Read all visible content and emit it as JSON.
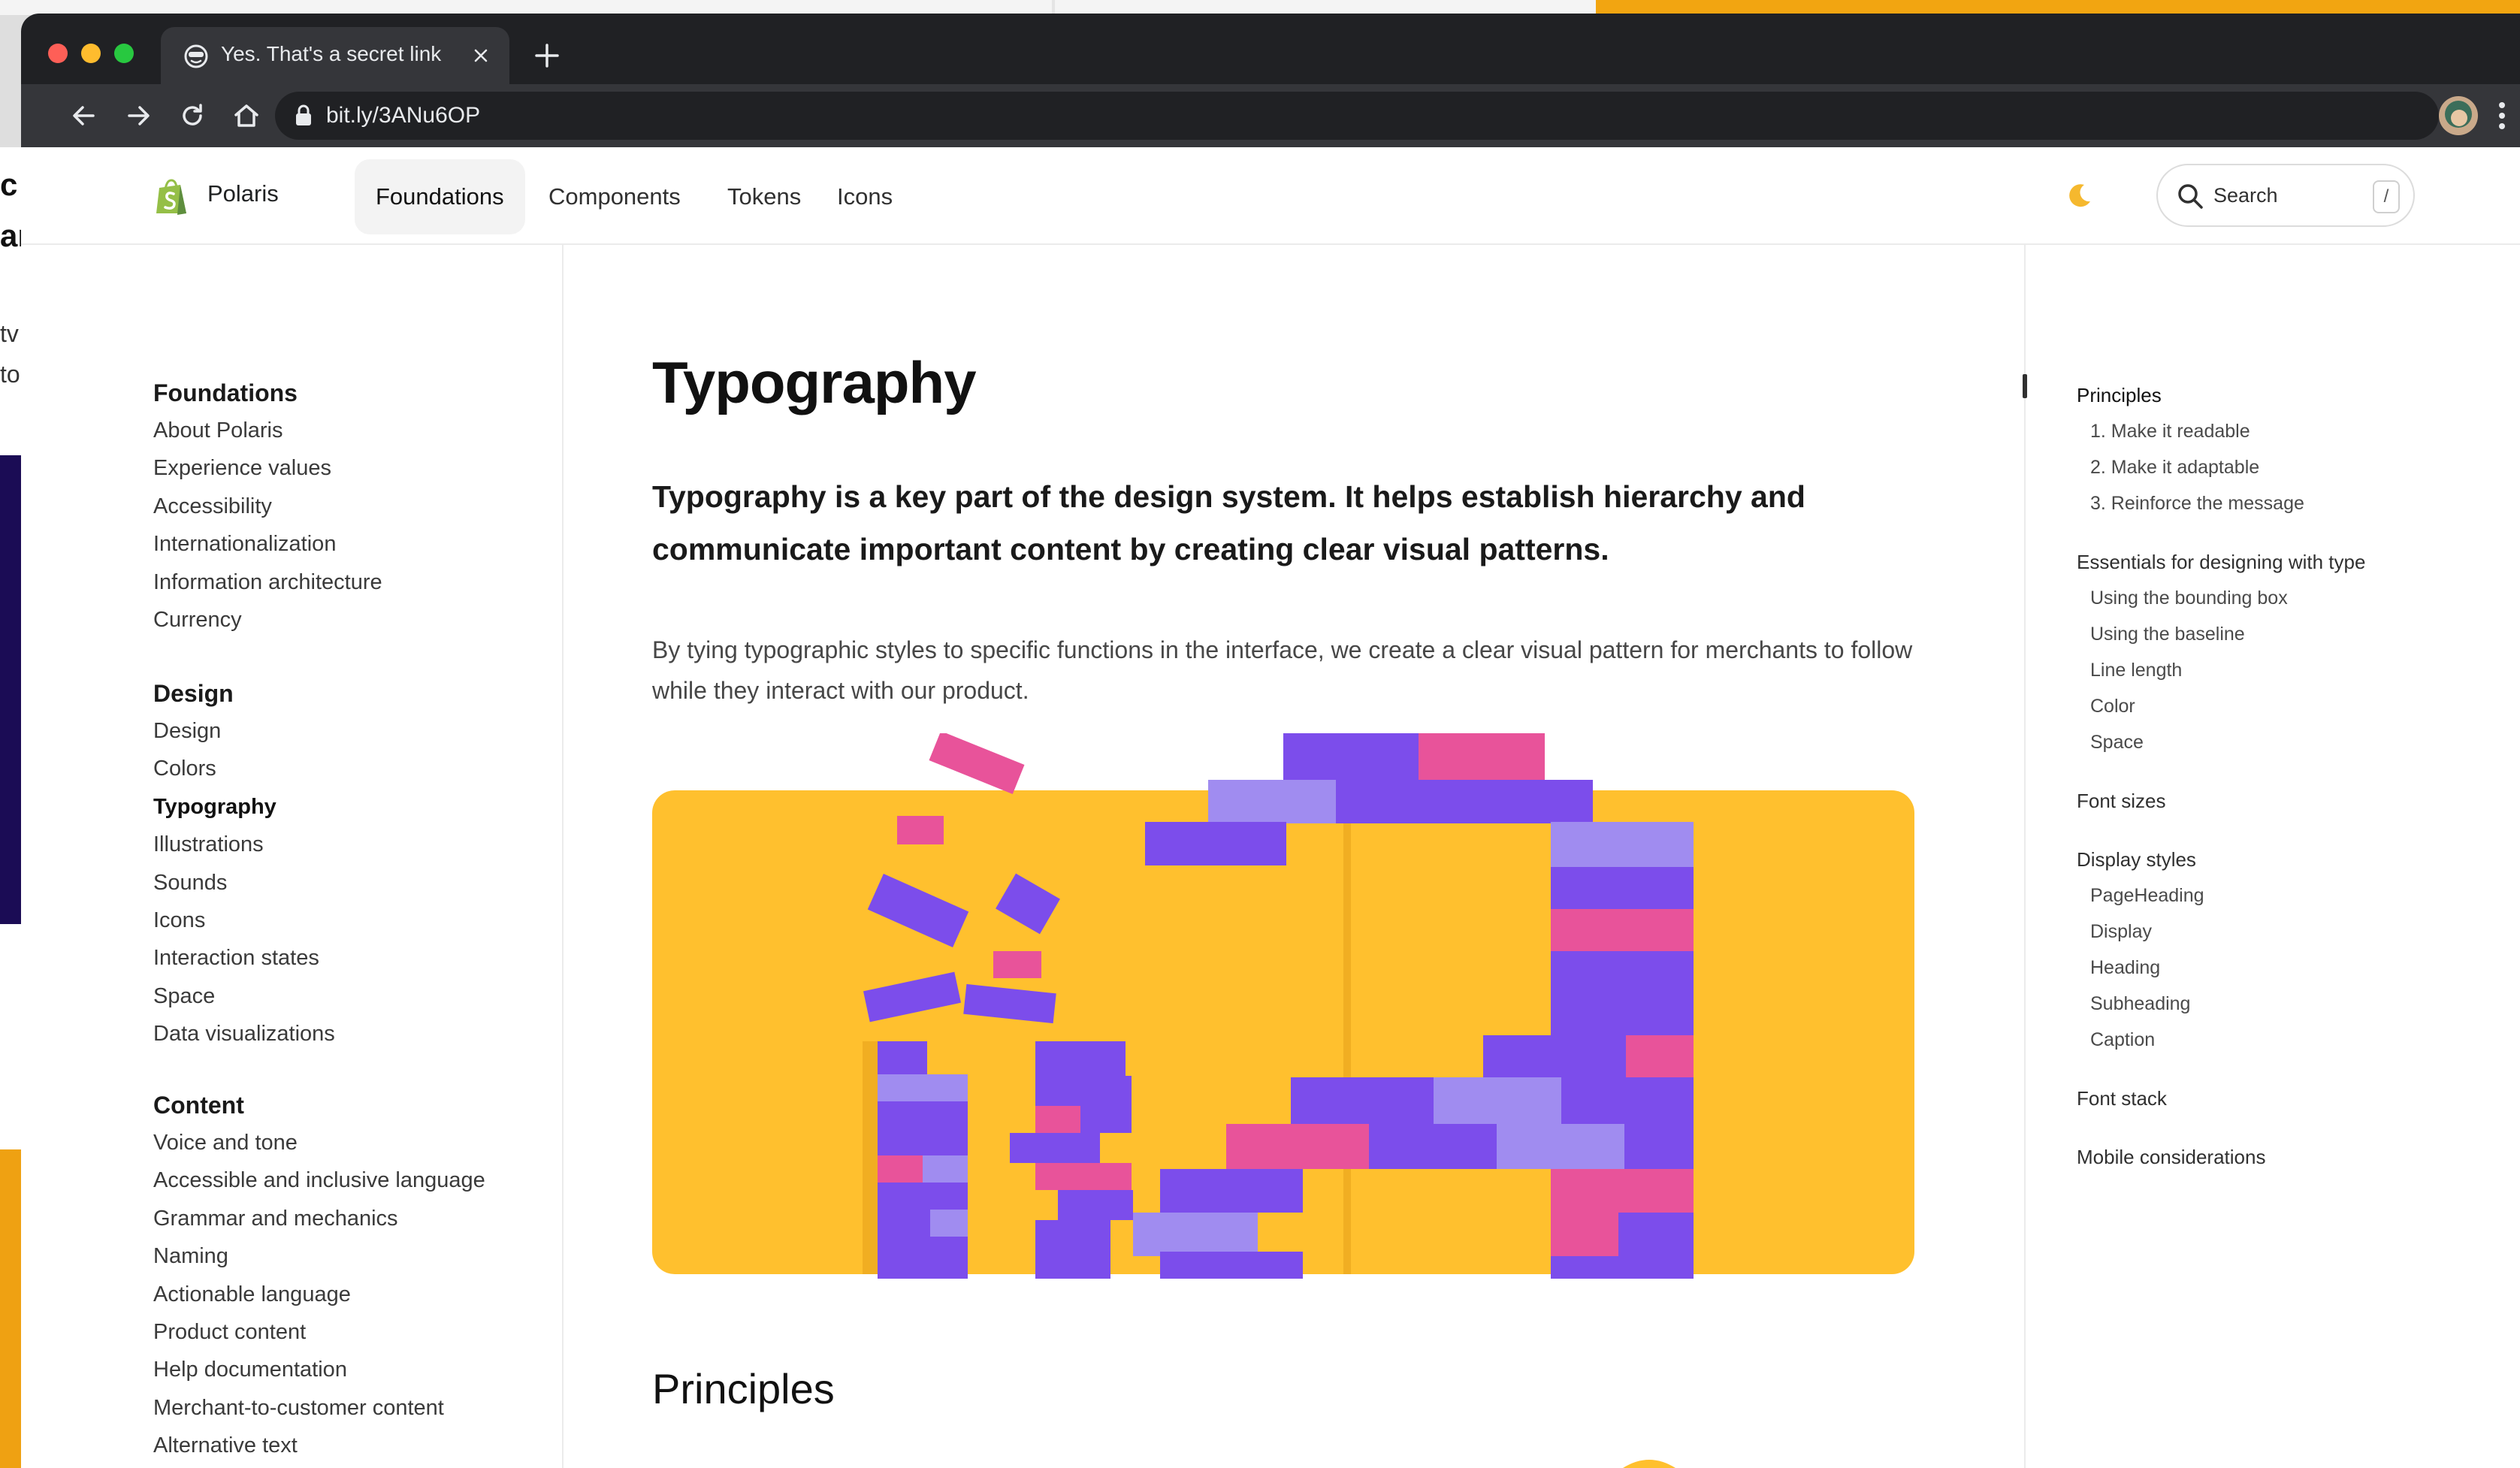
{
  "browser": {
    "tab_title": "Yes. That's a secret link",
    "url": "bit.ly/3ANu6OP"
  },
  "background": {
    "left_letters": [
      "c",
      "ar",
      "tv",
      "to"
    ]
  },
  "site": {
    "brand": "Polaris",
    "nav": [
      "Foundations",
      "Components",
      "Tokens",
      "Icons"
    ],
    "active_nav": "Foundations",
    "search_label": "Search",
    "search_shortcut": "/"
  },
  "sidebar": {
    "groups": [
      {
        "heading": "Foundations",
        "items": [
          "About Polaris",
          "Experience values",
          "Accessibility",
          "Internationalization",
          "Information architecture",
          "Currency"
        ]
      },
      {
        "heading": "Design",
        "items": [
          "Design",
          "Colors",
          "Typography",
          "Illustrations",
          "Sounds",
          "Icons",
          "Interaction states",
          "Space",
          "Data visualizations"
        ]
      },
      {
        "heading": "Content",
        "items": [
          "Voice and tone",
          "Accessible and inclusive language",
          "Grammar and mechanics",
          "Naming",
          "Actionable language",
          "Product content",
          "Help documentation",
          "Merchant-to-customer content",
          "Alternative text"
        ]
      }
    ],
    "active_item": "Typography"
  },
  "main": {
    "title": "Typography",
    "lead": "Typography is a key part of the design system. It helps establish hierarchy and communicate important content by creating clear visual patterns.",
    "body": "By tying typographic styles to specific functions in the interface, we create a clear visual pattern for merchants to follow while they interact with our product.",
    "section_heading": "Principles"
  },
  "toc": {
    "sections": [
      {
        "heading": "Principles",
        "items": [
          "1. Make it readable",
          "2. Make it adaptable",
          "3. Reinforce the message"
        ]
      },
      {
        "heading": "Essentials for designing with type",
        "items": [
          "Using the bounding box",
          "Using the baseline",
          "Line length",
          "Color",
          "Space"
        ]
      },
      {
        "heading": "Font sizes",
        "items": []
      },
      {
        "heading": "Display styles",
        "items": [
          "PageHeading",
          "Display",
          "Heading",
          "Subheading",
          "Caption"
        ]
      },
      {
        "heading": "Font stack",
        "items": []
      },
      {
        "heading": "Mobile considerations",
        "items": []
      }
    ],
    "active": "Principles"
  },
  "colors": {
    "hero_background": "#FFC02E",
    "brick_purple": "#7C4DEB",
    "brick_light_purple": "#A08CF0",
    "brick_pink": "#E8539A",
    "browser_chrome": "#202124"
  }
}
